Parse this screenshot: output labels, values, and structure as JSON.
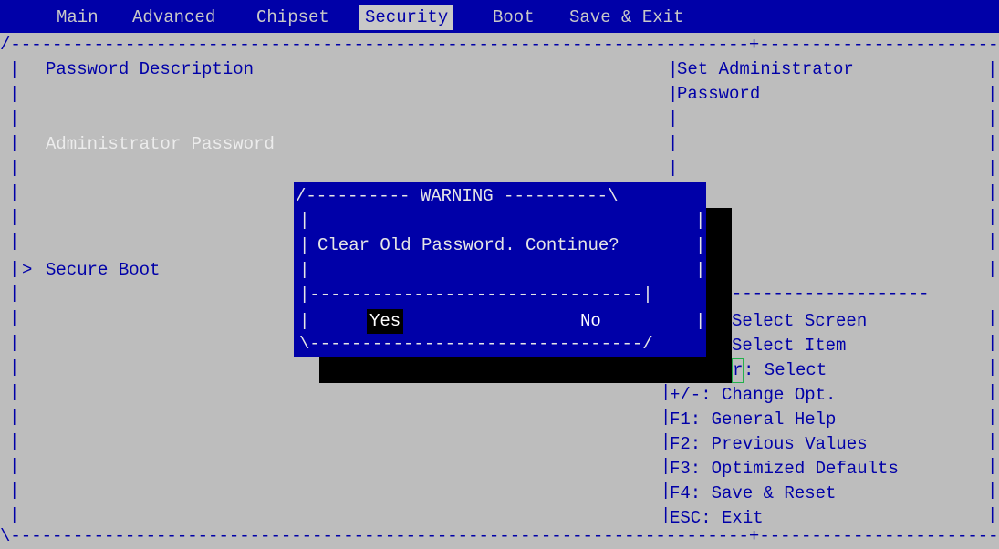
{
  "menu": {
    "tabs": [
      {
        "label": "Main"
      },
      {
        "label": "Advanced"
      },
      {
        "label": "Chipset"
      },
      {
        "label": "Security"
      },
      {
        "label": "Boot"
      },
      {
        "label": "Save & Exit"
      }
    ],
    "active": "Security"
  },
  "main": {
    "password_description": "Password Description",
    "admin_password": "Administrator Password",
    "secure_boot": "Secure Boot",
    "submenu_marker": ">"
  },
  "help": {
    "line1": "Set Administrator",
    "line2": "Password"
  },
  "keys": {
    "select_screen": "Select Screen",
    "select_item": "Select Item",
    "enter_partial": "r",
    "enter_select": ": Select",
    "change_opt": "+/-: Change Opt.",
    "general_help": "F1: General Help",
    "previous_values": "F2: Previous Values",
    "optimized_defaults": "F3: Optimized Defaults",
    "save_reset": "F4: Save & Reset",
    "exit": "ESC: Exit"
  },
  "dialog": {
    "title": "WARNING",
    "message": "Clear Old Password. Continue?",
    "yes": "Yes",
    "no": "No"
  }
}
